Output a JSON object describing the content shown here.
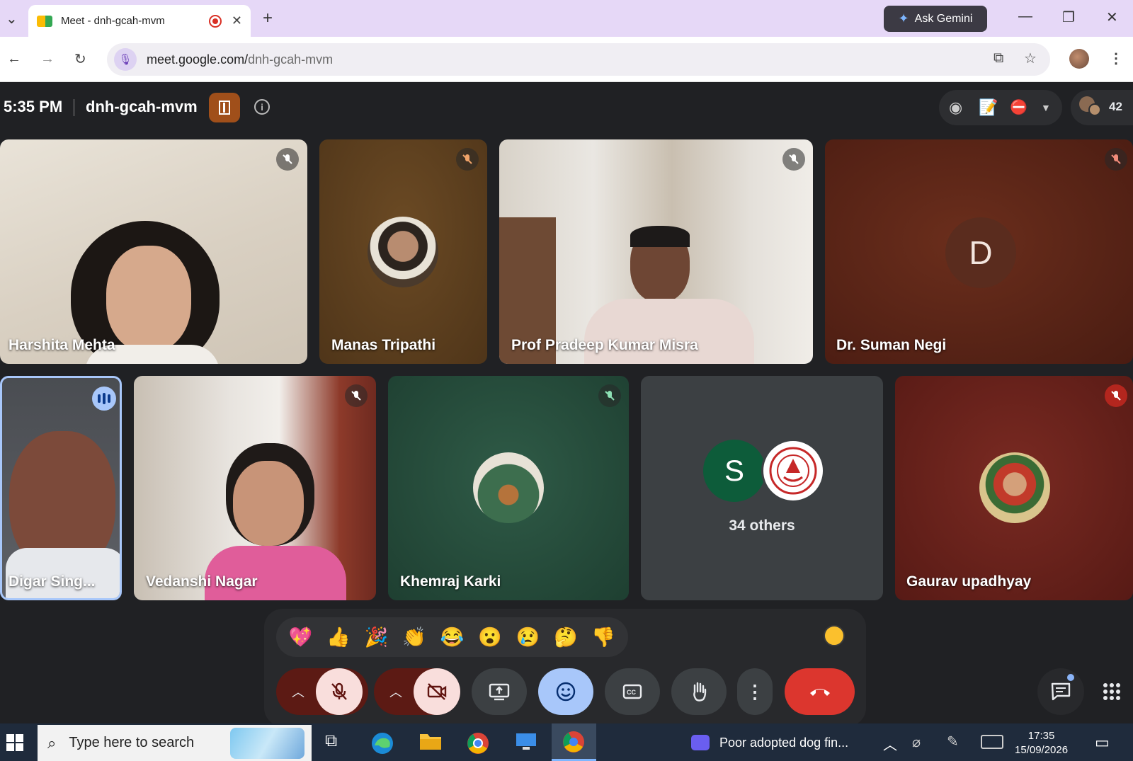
{
  "browser": {
    "tab_title": "Meet - dnh-gcah-mvm",
    "new_tab": "+",
    "close_tab": "✕",
    "ask_gemini": "Ask Gemini",
    "url_domain": "meet.google.com/",
    "url_path": "dnh-gcah-mvm"
  },
  "meeting": {
    "time": "5:35 PM",
    "code": "dnh-gcah-mvm",
    "participant_count": "42"
  },
  "tiles": [
    {
      "name": "Harshita Mehta"
    },
    {
      "name": "Manas Tripathi"
    },
    {
      "name": "Prof Pradeep Kumar Misra"
    },
    {
      "name": "Dr. Suman Negi",
      "initial": "D"
    },
    {
      "name": "Digar Sing..."
    },
    {
      "name": "Vedanshi Nagar"
    },
    {
      "name": "Khemraj Karki"
    },
    {
      "label": "34 others",
      "initial": "S"
    },
    {
      "name": "Gaurav upadhyay"
    }
  ],
  "reactions": [
    "💖",
    "👍",
    "🎉",
    "👏",
    "😂",
    "😮",
    "😢",
    "🤔",
    "👎"
  ],
  "taskbar": {
    "search_placeholder": "Type here to search",
    "media_title": "Poor adopted dog fin...",
    "time": "17:35",
    "date": "15/09/2026"
  },
  "colors": {
    "meet_bg": "#202124",
    "end_call": "#dc362e",
    "mic_off_bg": "#f9dedc",
    "reactions_active": "#a8c7fa"
  }
}
